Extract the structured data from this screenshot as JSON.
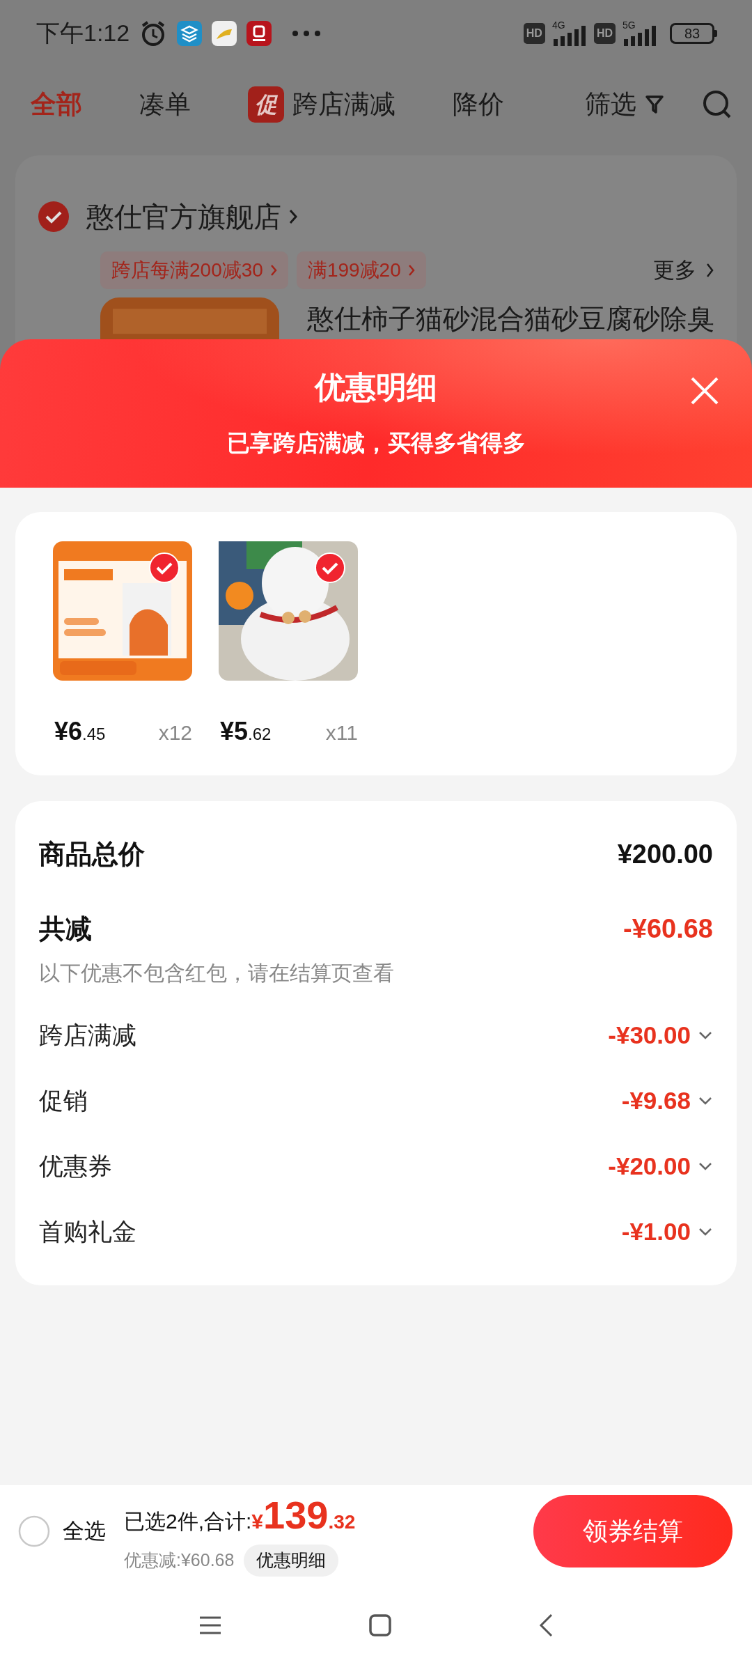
{
  "status_bar": {
    "time": "下午1:12",
    "sims": [
      {
        "hd": "HD",
        "network": "4G"
      },
      {
        "hd": "HD",
        "network": "5G"
      }
    ],
    "battery": "83"
  },
  "tabs": [
    {
      "label": "全部",
      "selected": true
    },
    {
      "label": "凑单",
      "selected": false
    },
    {
      "label": "跨店满减",
      "badge": "促",
      "selected": false
    },
    {
      "label": "降价",
      "selected": false
    },
    {
      "label": "筛选",
      "selected": false
    }
  ],
  "store": {
    "name": "憨仕官方旗舰店",
    "checked": true,
    "promos": [
      "跨店每满200减30",
      "满199减20"
    ],
    "more": "更多",
    "product_title": "憨仕柿子猫砂混合猫砂豆腐砂除臭"
  },
  "modal": {
    "title": "优惠明细",
    "subtitle": "已享跨店满减，买得多省得多",
    "items": [
      {
        "price_int": "¥6",
        "price_dec": ".45",
        "qty": "x12",
        "selected": true
      },
      {
        "price_int": "¥5",
        "price_dec": ".62",
        "qty": "x11",
        "selected": true
      }
    ],
    "summary": {
      "total_label": "商品总价",
      "total": "¥200.00",
      "discount_label": "共减",
      "discount": "-¥60.68",
      "note": "以下优惠不包含红包，请在结算页查看",
      "rows": [
        {
          "label": "跨店满减",
          "amount": "-¥30.00"
        },
        {
          "label": "促销",
          "amount": "-¥9.68"
        },
        {
          "label": "优惠券",
          "amount": "-¥20.00"
        },
        {
          "label": "首购礼金",
          "amount": "-¥1.00"
        }
      ]
    }
  },
  "bottom_bar": {
    "select_all": "全选",
    "checked": false,
    "selected_text": "已选2件,合计:",
    "currency": "¥",
    "total_int": "139",
    "total_dec": ".32",
    "discount": "优惠减:¥60.68",
    "detail_button": "优惠明细",
    "checkout": "领券结算"
  }
}
